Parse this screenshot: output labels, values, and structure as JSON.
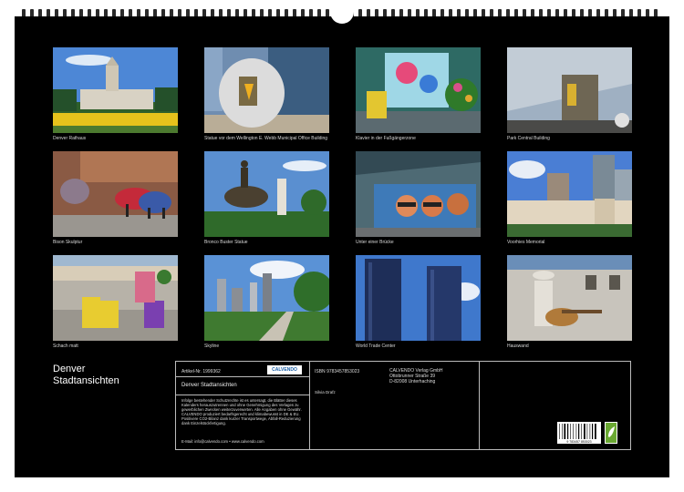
{
  "photos": [
    {
      "caption": "Denver Rathaus"
    },
    {
      "caption": "Statue vor dem Wellington E. Webb Municipal Office Building"
    },
    {
      "caption": "Klavier in der Fußgängerzone"
    },
    {
      "caption": "Park Central Building"
    },
    {
      "caption": "Bison Skulptur"
    },
    {
      "caption": "Bronco Buster Statue"
    },
    {
      "caption": "Unter einer Brücke"
    },
    {
      "caption": "Voorhies Memorial"
    },
    {
      "caption": "Schach matt"
    },
    {
      "caption": "Skyline"
    },
    {
      "caption": "World Trade Center"
    },
    {
      "caption": "Hauswand"
    }
  ],
  "calendar_title_line1": "Denver",
  "calendar_title_line2": "Stadtansichten",
  "info": {
    "article_label": "Artikel-Nr.",
    "article_number": "1999362",
    "publisher_logo": "CALVENDO",
    "product_title": "Denver Stadtansichten",
    "isbn_label": "ISBN",
    "isbn": "9783457853023",
    "publisher_name": "CALVENDO Verlag GmbH",
    "publisher_street": "Ottobrunner Straße 39",
    "publisher_city": "D-82008 Unterhaching",
    "author": "Silvia Drafz",
    "legal_text": "Infolge bestehender Schutzrechte ist es untersagt, die Blätter dieses Kalenders herauszutrennen und ohne Genehmigung des Verlages zu gewerblichen Zwecken weiterzuverwerten. Alle Angaben ohne Gewähr. CALVENDO produziert bedarfsgerecht und klimabewusst in DE & EU. Positivere CO2-Bilanz dank kurzer Transportwege, Abfall-Reduzierung dank Einzelstückfertigung.",
    "contact": "E-Mail: info@calvendo.com • www.calvendo.com",
    "barcode_text": "9 783457 853023"
  },
  "colors": {
    "background": "#000000",
    "page": "#ffffff",
    "frame": "#bbbbbb"
  }
}
